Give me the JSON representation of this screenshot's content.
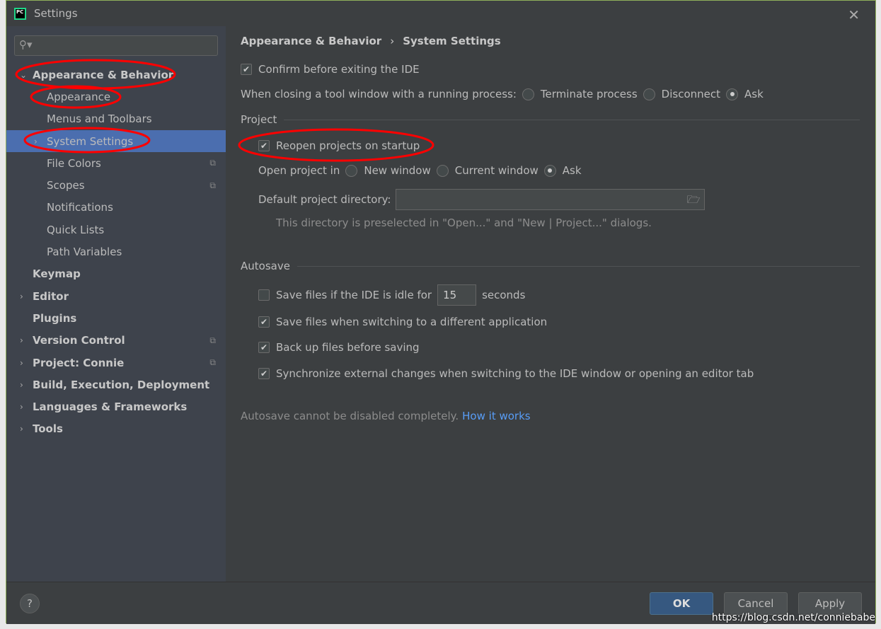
{
  "window": {
    "title": "Settings",
    "logo": "PC"
  },
  "sidebar": {
    "items": [
      {
        "label": "Appearance & Behavior",
        "level": 0,
        "expanded": true
      },
      {
        "label": "Appearance",
        "level": 1
      },
      {
        "label": "Menus and Toolbars",
        "level": 1
      },
      {
        "label": "System Settings",
        "level": 1,
        "selected": true,
        "arrow": true
      },
      {
        "label": "File Colors",
        "level": 1,
        "copy": true
      },
      {
        "label": "Scopes",
        "level": 1,
        "copy": true
      },
      {
        "label": "Notifications",
        "level": 1
      },
      {
        "label": "Quick Lists",
        "level": 1
      },
      {
        "label": "Path Variables",
        "level": 1
      },
      {
        "label": "Keymap",
        "level": 0
      },
      {
        "label": "Editor",
        "level": 0,
        "arrow": true
      },
      {
        "label": "Plugins",
        "level": 0
      },
      {
        "label": "Version Control",
        "level": 0,
        "arrow": true,
        "copy": true
      },
      {
        "label": "Project: Connie",
        "level": 0,
        "arrow": true,
        "copy": true
      },
      {
        "label": "Build, Execution, Deployment",
        "level": 0,
        "arrow": true
      },
      {
        "label": "Languages & Frameworks",
        "level": 0,
        "arrow": true
      },
      {
        "label": "Tools",
        "level": 0,
        "arrow": true
      }
    ]
  },
  "breadcrumb": {
    "parent": "Appearance & Behavior",
    "sep": "›",
    "current": "System Settings"
  },
  "main": {
    "confirm_exit": "Confirm before exiting the IDE",
    "closing_label": "When closing a tool window with a running process:",
    "closing_options": [
      "Terminate process",
      "Disconnect",
      "Ask"
    ],
    "project_section": "Project",
    "reopen": "Reopen projects on startup",
    "open_in_label": "Open project in",
    "open_in_options": [
      "New window",
      "Current window",
      "Ask"
    ],
    "default_dir_label": "Default project directory:",
    "default_dir_value": "",
    "default_dir_hint": "This directory is preselected in \"Open...\" and \"New | Project...\" dialogs.",
    "autosave_section": "Autosave",
    "idle_label": "Save files if the IDE is idle for",
    "idle_value": "15",
    "idle_unit": "seconds",
    "switch_app": "Save files when switching to a different application",
    "backup": "Back up files before saving",
    "sync": "Synchronize external changes when switching to the IDE window or opening an editor tab",
    "autosave_note": "Autosave cannot be disabled completely.",
    "how_link": "How it works"
  },
  "footer": {
    "help": "?",
    "ok": "OK",
    "cancel": "Cancel",
    "apply": "Apply"
  },
  "watermark": "https://blog.csdn.net/conniebabe",
  "colors": {
    "accent": "#4b6eaf",
    "link": "#589df6",
    "annotation": "#ff0000"
  }
}
